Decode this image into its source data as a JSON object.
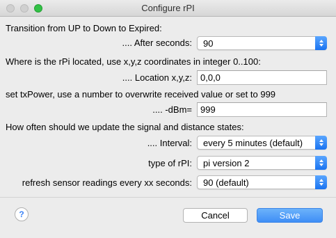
{
  "window": {
    "title": "Configure rPI"
  },
  "rows": {
    "transition_header": "Transition from UP to Down to Expired:",
    "after_seconds_label": "....  After seconds:",
    "after_seconds_value": "90",
    "location_header": "Where is the rPi located, use x,y,z coordinates in integer 0..100:",
    "location_label": "....  Location x,y,z:",
    "location_value": "0,0,0",
    "txpower_header": "set txPower, use a number to overwrite received value or set to 999",
    "dbm_label": ".... -dBm=",
    "dbm_value": "999",
    "update_header": "How often should we update the signal and distance states:",
    "interval_label": "....  Interval:",
    "interval_value": "every  5 minutes (default)",
    "type_label": "type of rPI:",
    "type_value": "pi version 2",
    "refresh_label": "refresh sensor readings every xx seconds:",
    "refresh_value": "90  (default)"
  },
  "footer": {
    "help_glyph": "?",
    "cancel_label": "Cancel",
    "save_label": "Save"
  },
  "colors": {
    "accent": "#1a73f0",
    "zoom_button": "#32c146",
    "background": "#ececec"
  },
  "icons": {
    "close": "close-icon",
    "minimize": "minimize-icon",
    "zoom": "zoom-icon",
    "stepper": "chevron-updown-icon",
    "help": "help-icon"
  }
}
